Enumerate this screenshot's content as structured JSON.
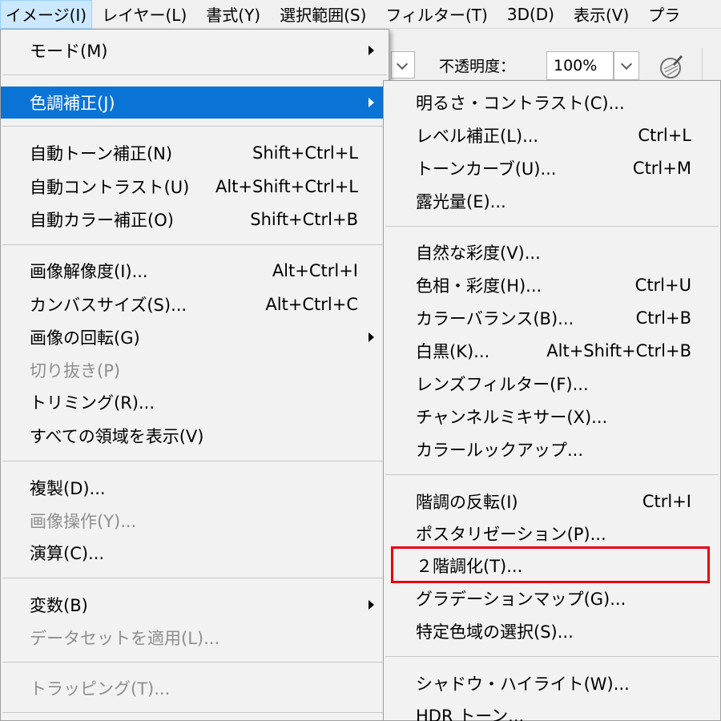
{
  "menubar": [
    {
      "label": "イメージ(I)",
      "name": "menubar-image"
    },
    {
      "label": "レイヤー(L)",
      "name": "menubar-layer"
    },
    {
      "label": "書式(Y)",
      "name": "menubar-type"
    },
    {
      "label": "選択範囲(S)",
      "name": "menubar-select"
    },
    {
      "label": "フィルター(T)",
      "name": "menubar-filter"
    },
    {
      "label": "3D(D)",
      "name": "menubar-3d"
    },
    {
      "label": "表示(V)",
      "name": "menubar-view"
    },
    {
      "label": "プラ",
      "name": "menubar-plugins"
    }
  ],
  "options_bar": {
    "opacity_label": "不透明度：",
    "opacity_value": "100%"
  },
  "image_menu": {
    "mode": "モード(M)",
    "adjustments": "色調補正(J)",
    "auto_tone": {
      "label": "自動トーン補正(N)",
      "shortcut": "Shift+Ctrl+L"
    },
    "auto_contrast": {
      "label": "自動コントラスト(U)",
      "shortcut": "Alt+Shift+Ctrl+L"
    },
    "auto_color": {
      "label": "自動カラー補正(O)",
      "shortcut": "Shift+Ctrl+B"
    },
    "image_size": {
      "label": "画像解像度(I)...",
      "shortcut": "Alt+Ctrl+I"
    },
    "canvas_size": {
      "label": "カンバスサイズ(S)...",
      "shortcut": "Alt+Ctrl+C"
    },
    "rotation": "画像の回転(G)",
    "crop": "切り抜き(P)",
    "trim": "トリミング(R)...",
    "reveal_all": "すべての領域を表示(V)",
    "duplicate": "複製(D)...",
    "apply_image": "画像操作(Y)...",
    "calculations": "演算(C)...",
    "variables": "変数(B)",
    "apply_dataset": "データセットを適用(L)...",
    "trap": "トラッピング(T)..."
  },
  "adjust_menu": {
    "brightness_contrast": "明るさ・コントラスト(C)...",
    "levels": {
      "label": "レベル補正(L)...",
      "shortcut": "Ctrl+L"
    },
    "curves": {
      "label": "トーンカーブ(U)...",
      "shortcut": "Ctrl+M"
    },
    "exposure": "露光量(E)...",
    "vibrance": "自然な彩度(V)...",
    "hue_saturation": {
      "label": "色相・彩度(H)...",
      "shortcut": "Ctrl+U"
    },
    "color_balance": {
      "label": "カラーバランス(B)...",
      "shortcut": "Ctrl+B"
    },
    "black_white": {
      "label": "白黒(K)...",
      "shortcut": "Alt+Shift+Ctrl+B"
    },
    "photo_filter": "レンズフィルター(F)...",
    "channel_mixer": "チャンネルミキサー(X)...",
    "color_lookup": "カラールックアップ...",
    "invert": {
      "label": "階調の反転(I)",
      "shortcut": "Ctrl+I"
    },
    "posterize": "ポスタリゼーション(P)...",
    "threshold": "２階調化(T)...",
    "gradient_map": "グラデーションマップ(G)...",
    "selective_color": "特定色域の選択(S)...",
    "shadows_highlights": "シャドウ・ハイライト(W)...",
    "hdr_toning": "HDR トーン..."
  },
  "colors": {
    "highlight": "#0a74d6",
    "callout": "#e60012",
    "disabled_text": "#8e8e8e"
  }
}
